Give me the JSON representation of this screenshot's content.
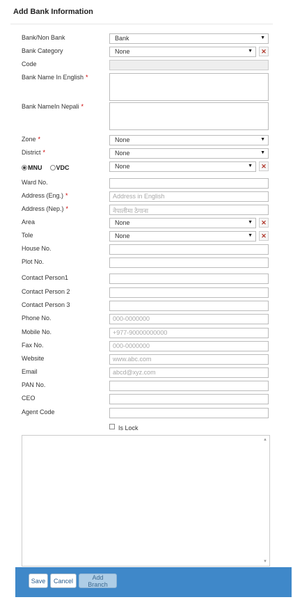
{
  "page": {
    "title": "Add Bank Information"
  },
  "form": {
    "bank_type": {
      "label": "Bank/Non Bank",
      "value": "Bank"
    },
    "bank_category": {
      "label": "Bank Category",
      "value": "None"
    },
    "code": {
      "label": "Code",
      "value": ""
    },
    "bank_name_english": {
      "label": "Bank Name In English",
      "required": "*",
      "value": ""
    },
    "bank_name_nepali": {
      "label": "Bank NameIn Nepali",
      "required": "*",
      "value": ""
    },
    "zone": {
      "label": "Zone",
      "required": "*",
      "value": "None"
    },
    "district": {
      "label": "District",
      "required": "*",
      "value": "None"
    },
    "municipality": {
      "option_mnu": "MNU",
      "option_vdc": "VDC",
      "selected": "MNU",
      "value": "None"
    },
    "ward_no": {
      "label": "Ward No.",
      "value": ""
    },
    "address_eng": {
      "label": "Address (Eng.)",
      "required": "*",
      "placeholder": "Address in English"
    },
    "address_nep": {
      "label": "Address (Nep.)",
      "required": "*",
      "placeholder": "नेपालीमा  ठेगाना"
    },
    "area": {
      "label": "Area",
      "value": "None"
    },
    "tole": {
      "label": "Tole",
      "value": "None"
    },
    "house_no": {
      "label": "House No.",
      "value": ""
    },
    "plot_no": {
      "label": "Plot No.",
      "value": ""
    },
    "contact_person1": {
      "label": "Contact Person1",
      "value": ""
    },
    "contact_person2": {
      "label": "Contact Person 2",
      "value": ""
    },
    "contact_person3": {
      "label": "Contact Person 3",
      "value": ""
    },
    "phone_no": {
      "label": "Phone No.",
      "placeholder": "000-0000000"
    },
    "mobile_no": {
      "label": "Mobile No.",
      "placeholder": "+977-90000000000"
    },
    "fax_no": {
      "label": "Fax No.",
      "placeholder": "000-0000000"
    },
    "website": {
      "label": "Website",
      "placeholder": "www.abc.com"
    },
    "email": {
      "label": "Email",
      "placeholder": "abcd@xyz.com"
    },
    "pan_no": {
      "label": "PAN No.",
      "value": ""
    },
    "ceo": {
      "label": "CEO",
      "value": ""
    },
    "agent_code": {
      "label": "Agent Code",
      "value": ""
    },
    "is_lock": {
      "label": "Is Lock",
      "checked": false
    }
  },
  "footer": {
    "save_label": "Save",
    "cancel_label": "Cancel",
    "add_branch_label": "Add Branch"
  },
  "icons": {
    "dropdown": "chevron-down-icon",
    "tool": "tools-icon",
    "scroll_up": "scroll-up-icon",
    "scroll_down": "scroll-down-icon"
  },
  "colors": {
    "footer_bar": "#3f88c9",
    "required_marker": "#cc0000",
    "tool_icon": "#b23a2e",
    "disabled_field": "#eeeeee"
  }
}
